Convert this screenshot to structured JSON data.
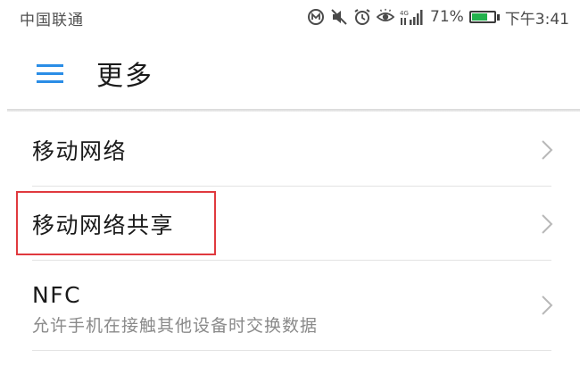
{
  "status_bar": {
    "carrier": "中国联通",
    "network_type": "4G",
    "battery_percent": "71%",
    "battery_level": 0.71,
    "time": "下午3:41",
    "icons": [
      "nfc-icon",
      "mute-icon",
      "alarm-icon",
      "eye-icon",
      "signal-icon",
      "battery-icon"
    ]
  },
  "header": {
    "menu_icon": "hamburger-menu-icon",
    "title": "更多"
  },
  "list": {
    "items": [
      {
        "title": "移动网络",
        "subtitle": ""
      },
      {
        "title": "移动网络共享",
        "subtitle": "",
        "highlighted": true
      },
      {
        "title": "NFC",
        "subtitle": "允许手机在接触其他设备时交换数据"
      }
    ]
  },
  "colors": {
    "accent": "#2a8de6",
    "highlight_border": "#e0393e",
    "battery_fill": "#22b14c",
    "title_text": "#1a1a1a",
    "subtitle_text": "#8a8a8a",
    "divider": "#e3e3e3"
  }
}
